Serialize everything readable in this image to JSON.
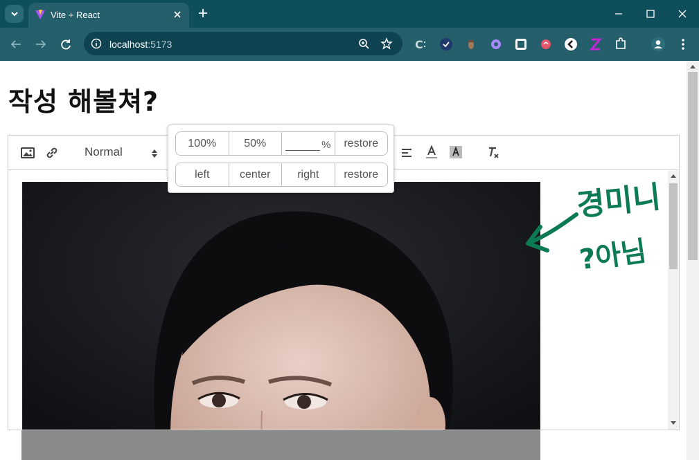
{
  "browser": {
    "tab_title": "Vite + React",
    "url_host": "localhost",
    "url_port": ":5173",
    "accent": "#0f4e5b"
  },
  "page": {
    "title": "작성 해볼쳐?"
  },
  "editor": {
    "header_picker": "Normal"
  },
  "resize_popover": {
    "size_buttons": [
      "100%",
      "50%",
      "restore"
    ],
    "percent_unit": "%",
    "percent_value": "",
    "align_buttons": [
      "left",
      "center",
      "right",
      "restore"
    ]
  },
  "annotation": {
    "line1": "경미니",
    "line2": "?아님",
    "color": "#0c7a52"
  }
}
